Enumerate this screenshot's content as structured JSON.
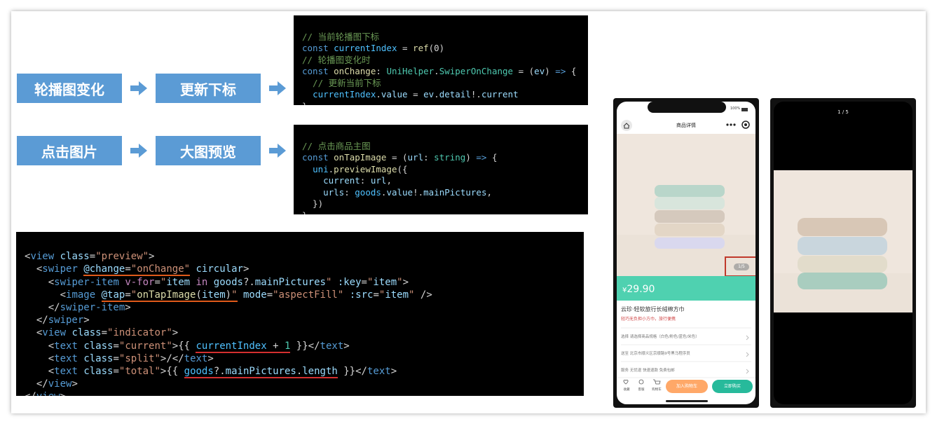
{
  "flow": {
    "row1": [
      "轮播图变化",
      "更新下标"
    ],
    "row2": [
      "点击图片",
      "大图预览"
    ]
  },
  "code1": {
    "l1": "// 当前轮播图下标",
    "l2a": "const ",
    "l2b": "currentIndex",
    "l2c": " = ",
    "l2d": "ref",
    "l2e": "(0)",
    "l3": "// 轮播图变化时",
    "l4a": "const ",
    "l4b": "onChange",
    "l4c": ": ",
    "l4d": "UniHelper",
    "l4e": ".",
    "l4f": "SwiperOnChange",
    "l4g": " = (",
    "l4h": "ev",
    "l4i": ") ",
    "l4j": "=>",
    "l4k": " {",
    "l5": "  // 更新当前下标",
    "l6a": "  ",
    "l6b": "currentIndex",
    "l6c": ".",
    "l6d": "value",
    "l6e": " = ",
    "l6f": "ev",
    "l6g": ".",
    "l6h": "detail",
    "l6i": "!.",
    "l6j": "current",
    "l7": "}"
  },
  "code2": {
    "l1": "// 点击商品主图",
    "l2a": "const ",
    "l2b": "onTapImage",
    "l2c": " = (",
    "l2d": "url",
    "l2e": ": ",
    "l2f": "string",
    "l2g": ") ",
    "l2h": "=>",
    "l2i": " {",
    "l3a": "  ",
    "l3b": "uni",
    "l3c": ".",
    "l3d": "previewImage",
    "l3e": "({",
    "l4a": "    ",
    "l4b": "current",
    "l4c": ": ",
    "l4d": "url",
    "l4e": ",",
    "l5a": "    ",
    "l5b": "urls",
    "l5c": ": ",
    "l5d": "goods",
    "l5e": ".",
    "l5f": "value",
    "l5g": "!.",
    "l5h": "mainPictures",
    "l5i": ",",
    "l6": "  })",
    "l7": "}"
  },
  "code3": {
    "l1": [
      "<",
      "view",
      " ",
      "class",
      "=",
      "\"preview\"",
      ">"
    ],
    "l2": [
      "  <",
      "swiper",
      " ",
      "@change",
      "=",
      "\"onChange\"",
      " ",
      "circular",
      ">"
    ],
    "l3": [
      "    <",
      "swiper-item",
      " ",
      "v-for",
      "=",
      "\"",
      "item",
      " in ",
      "goods",
      "?.",
      "mainPictures",
      "\"",
      " ",
      ":key",
      "=",
      "\"",
      "item",
      "\"",
      ">"
    ],
    "l4": [
      "      <",
      "image",
      " ",
      "@tap",
      "=",
      "\"",
      "onTapImage",
      "(",
      "item",
      ")",
      "\"",
      " ",
      "mode",
      "=",
      "\"aspectFill\"",
      " ",
      ":src",
      "=",
      "\"",
      "item",
      "\"",
      " />"
    ],
    "l5": [
      "    </",
      "swiper-item",
      ">"
    ],
    "l6": [
      "  </",
      "swiper",
      ">"
    ],
    "l7": [
      "  <",
      "view",
      " ",
      "class",
      "=",
      "\"indicator\"",
      ">"
    ],
    "l8": [
      "    <",
      "text",
      " ",
      "class",
      "=",
      "\"current\"",
      ">{{ ",
      "currentIndex",
      " + ",
      "1",
      " }}</",
      "text",
      ">"
    ],
    "l9": [
      "    <",
      "text",
      " ",
      "class",
      "=",
      "\"split\"",
      ">/</",
      "text",
      ">"
    ],
    "l10": [
      "    <",
      "text",
      " ",
      "class",
      "=",
      "\"total\"",
      ">{{ ",
      "goods",
      "?.",
      "mainPictures",
      ".",
      "length",
      " }}</",
      "text",
      ">"
    ],
    "l11": [
      "  </",
      "view",
      ">"
    ],
    "l12": [
      "</",
      "view",
      ">"
    ]
  },
  "phone1": {
    "status_battery": "100%",
    "nav_title": "商品详情",
    "home_icon": "home-icon",
    "more_icon": "more-dots-icon",
    "target_icon": "target-icon",
    "indicator": "1/5",
    "price_symbol": "¥",
    "price": "29.90",
    "product_name": "云珍·轻软旅行长绒棉方巾",
    "product_desc": "轻巧无负担小方巾，旅行便携",
    "row1": "选择  请选择商品规格（白色/粉色/蓝色/米色）",
    "row2": "送至  北京市顺义区京顺路9号黑马程序员",
    "row3": "服务  无忧退 快速退款 免费包邮",
    "tab_fav": "收藏",
    "tab_service": "客服",
    "tab_cart": "购物车",
    "btn_cart": "加入购物车",
    "btn_buy": "立即购买",
    "colors": {
      "primary": "#27ba9b",
      "price_bg": "#4fd1b0",
      "cart_btn": "#ffa868",
      "buy_btn": "#27ba9b",
      "highlight": "#c0392b"
    }
  },
  "phone2": {
    "indicator": "1 / 5"
  }
}
